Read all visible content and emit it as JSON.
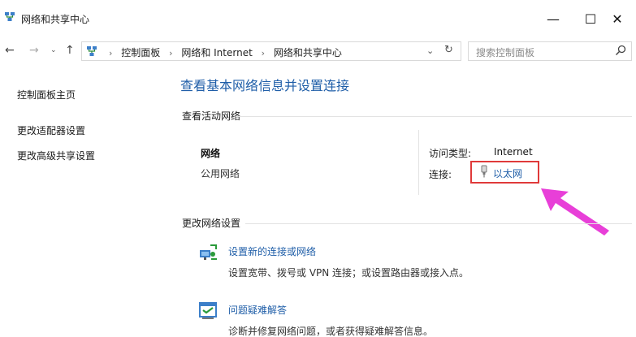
{
  "window": {
    "title": "网络和共享中心",
    "controls": {
      "minimize": "—",
      "maximize": "☐",
      "close": "✕"
    }
  },
  "nav": {
    "back": "←",
    "forward": "→",
    "recent": "⌄",
    "up": "↑",
    "breadcrumbs": [
      "控制面板",
      "网络和 Internet",
      "网络和共享中心"
    ],
    "separator": "›",
    "dropdown": "⌄",
    "refresh": "↻",
    "search_placeholder": "搜索控制面板"
  },
  "sidebar": {
    "items": [
      {
        "label": "控制面板主页"
      },
      {
        "label": "更改适配器设置"
      },
      {
        "label": "更改高级共享设置"
      }
    ]
  },
  "main": {
    "title": "查看基本网络信息并设置连接",
    "active_networks_heading": "查看活动网络",
    "network": {
      "name": "网络",
      "type": "公用网络",
      "access_type_label": "访问类型:",
      "access_type_value": "Internet",
      "connection_label": "连接:",
      "connection_value": "以太网"
    },
    "change_settings_heading": "更改网络设置",
    "tasks": [
      {
        "title": "设置新的连接或网络",
        "description": "设置宽带、拨号或 VPN 连接；或设置路由器或接入点。",
        "icon": "network-setup-icon"
      },
      {
        "title": "问题疑难解答",
        "description": "诊断并修复网络问题，或者获得疑难解答信息。",
        "icon": "troubleshoot-icon"
      }
    ]
  },
  "colors": {
    "link": "#1f5ea8",
    "highlight_box": "#e03a3a",
    "annotation_arrow": "#e83fd8"
  }
}
